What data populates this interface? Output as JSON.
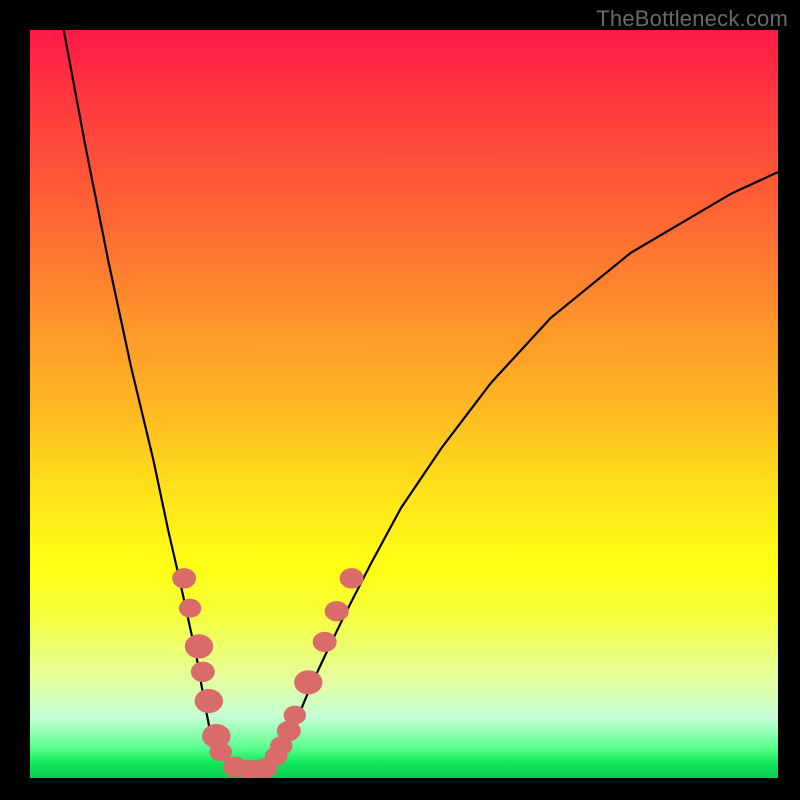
{
  "watermark": "TheBottleneck.com",
  "colors": {
    "background": "#000000",
    "curve": "#000000",
    "marker": "#d96b6b",
    "gradient_top": "#ff1947",
    "gradient_bottom": "#0acb4f"
  },
  "chart_data": {
    "type": "line",
    "title": "",
    "xlabel": "",
    "ylabel": "",
    "xlim": [
      0,
      100
    ],
    "ylim": [
      0,
      100
    ],
    "grid": false,
    "note": "Values are estimated from pixel positions; axes are unlabeled in the source image. y is interpreted as 0 at bottom (green) to 100 at top (red).",
    "series": [
      {
        "name": "left-curve",
        "x": [
          4.5,
          7.5,
          10.5,
          13.5,
          16.5,
          18.5,
          20.0,
          21.2,
          22.3,
          23.0,
          23.6,
          24.0,
          24.7,
          25.4,
          26.7,
          28.1,
          30.1
        ],
        "y": [
          100.0,
          84.0,
          69.0,
          55.0,
          42.5,
          33.0,
          26.5,
          21.0,
          16.0,
          12.0,
          8.7,
          6.7,
          4.7,
          3.3,
          1.9,
          1.1,
          0.9
        ]
      },
      {
        "name": "right-curve",
        "x": [
          30.1,
          31.4,
          32.7,
          33.5,
          34.3,
          35.0,
          36.2,
          37.6,
          39.6,
          42.2,
          45.6,
          49.6,
          55.0,
          61.6,
          69.6,
          80.3,
          93.7,
          100.0
        ],
        "y": [
          0.9,
          1.3,
          2.5,
          3.9,
          5.1,
          6.4,
          9.1,
          12.4,
          16.7,
          22.1,
          28.7,
          36.1,
          44.1,
          52.8,
          61.5,
          70.2,
          78.1,
          81.0
        ]
      }
    ],
    "markers": {
      "name": "highlight-points",
      "note": "Salmon circular markers clustered near the trough.",
      "points": [
        {
          "x": 20.6,
          "y": 26.7,
          "r": 1.6
        },
        {
          "x": 21.4,
          "y": 22.7,
          "r": 1.5
        },
        {
          "x": 22.6,
          "y": 17.6,
          "r": 1.9
        },
        {
          "x": 23.1,
          "y": 14.2,
          "r": 1.6
        },
        {
          "x": 23.9,
          "y": 10.3,
          "r": 1.9
        },
        {
          "x": 24.9,
          "y": 5.6,
          "r": 1.9
        },
        {
          "x": 25.5,
          "y": 3.5,
          "r": 1.5
        },
        {
          "x": 27.4,
          "y": 1.5,
          "r": 1.6
        },
        {
          "x": 29.4,
          "y": 1.1,
          "r": 1.6
        },
        {
          "x": 31.4,
          "y": 1.3,
          "r": 1.6
        },
        {
          "x": 32.9,
          "y": 2.9,
          "r": 1.5
        },
        {
          "x": 33.6,
          "y": 4.3,
          "r": 1.5
        },
        {
          "x": 34.6,
          "y": 6.3,
          "r": 1.6
        },
        {
          "x": 35.4,
          "y": 8.4,
          "r": 1.5
        },
        {
          "x": 37.2,
          "y": 12.8,
          "r": 1.9
        },
        {
          "x": 39.4,
          "y": 18.2,
          "r": 1.6
        },
        {
          "x": 41.0,
          "y": 22.3,
          "r": 1.6
        },
        {
          "x": 43.0,
          "y": 26.7,
          "r": 1.6
        }
      ]
    }
  }
}
